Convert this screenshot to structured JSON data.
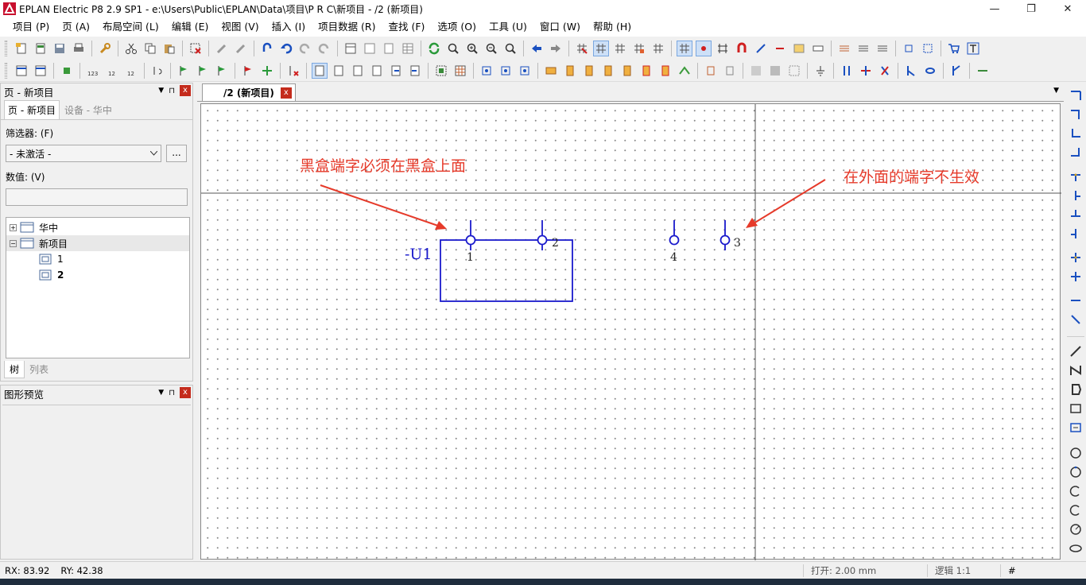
{
  "window": {
    "title": "EPLAN Electric P8 2.9 SP1 - e:\\Users\\Public\\EPLAN\\Data\\项目\\P R C\\新项目 - /2 (新项目)",
    "minimize": "—",
    "restore": "❐",
    "close": "✕"
  },
  "menu": [
    "项目 (P)",
    "页 (A)",
    "布局空间 (L)",
    "编辑 (E)",
    "视图 (V)",
    "插入 (I)",
    "项目数据 (R)",
    "查找 (F)",
    "选项 (O)",
    "工具 (U)",
    "窗口 (W)",
    "帮助 (H)"
  ],
  "page_panel": {
    "title": "页 - 新项目",
    "tabs": [
      "页 - 新项目",
      "设备 - 华中"
    ],
    "filter_label": "筛选器: (F)",
    "filter_value": "- 未激活 -",
    "browse_label": "...",
    "value_label": "数值: (V)",
    "value_input": "",
    "tree": [
      {
        "label": "华中",
        "expander": "+"
      },
      {
        "label": "新项目",
        "expander": "−"
      },
      {
        "label": "1"
      },
      {
        "label": "2"
      }
    ],
    "bottom_tabs": [
      "树",
      "列表"
    ]
  },
  "preview_panel": {
    "title": "图形预览"
  },
  "panel_buttons": {
    "dropdown": "▼",
    "pin": "⊓",
    "close": "x"
  },
  "document_tab": {
    "label": "/2 (新项目)",
    "close": "x"
  },
  "tabstrip_menu": "▼",
  "drawing": {
    "device_tag": "-U1",
    "terminals": [
      "1",
      "2",
      "4",
      "3"
    ],
    "annotation_left": "黑盒端字必须在黑盒上面",
    "annotation_right": "在外面的端字不生效",
    "annotation_color": "#e63a2a",
    "symbol_color": "#1a1acc"
  },
  "status": {
    "rx": "RX: 83.92",
    "ry": "RY: 42.38",
    "open": "打开: 2.00 mm",
    "logic": "逻辑 1:1",
    "hash": "#"
  }
}
